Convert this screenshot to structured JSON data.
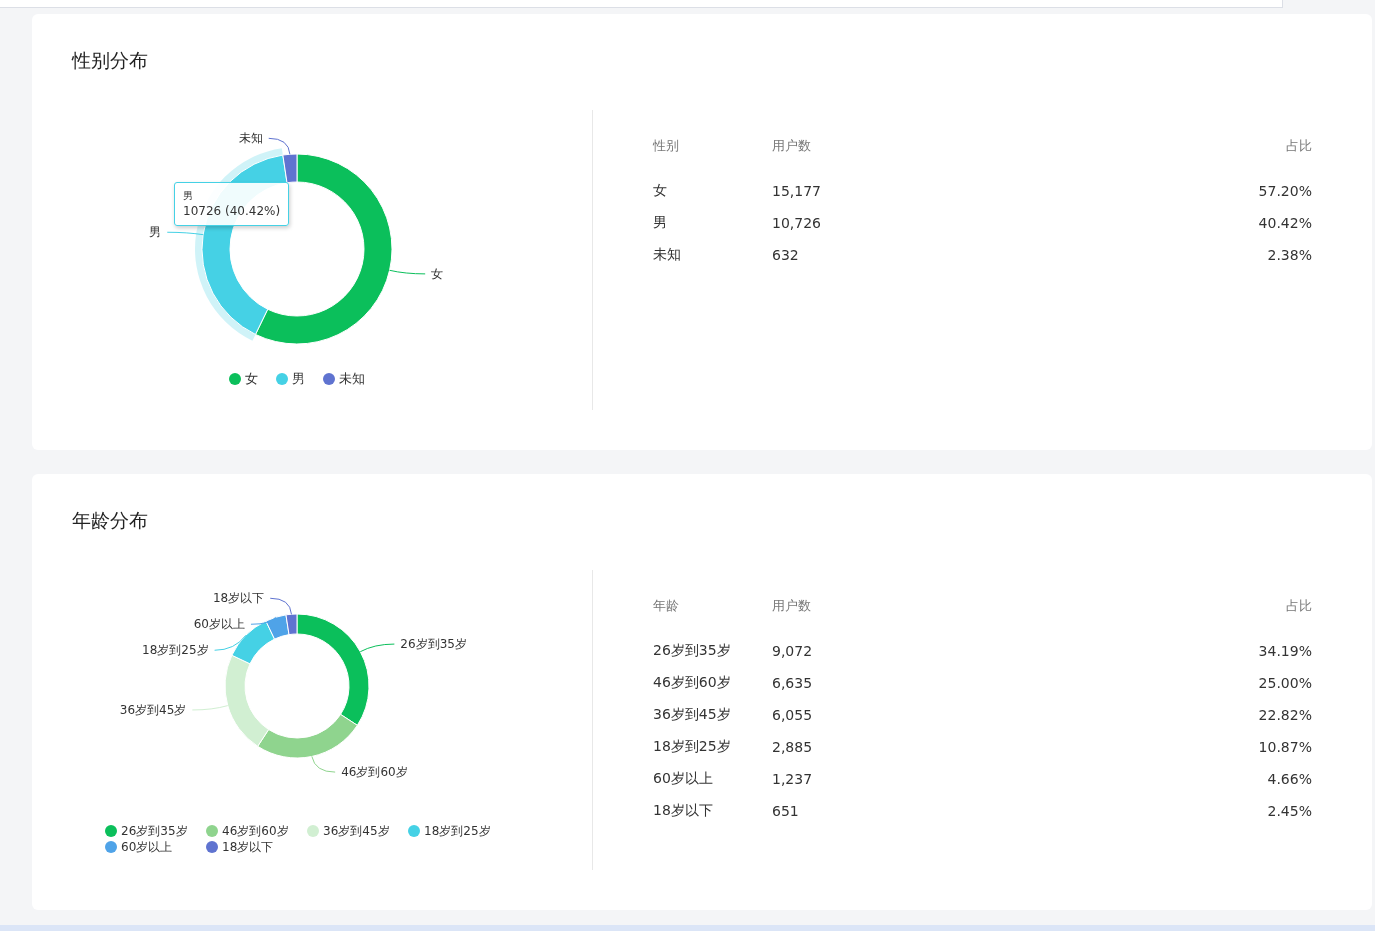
{
  "sections": [
    {
      "title": "性别分布",
      "chart": {
        "chart_data": {
          "type": "donut",
          "categories": [
            "女",
            "男",
            "未知"
          ],
          "values": [
            57.2,
            40.42,
            2.38
          ],
          "colors": [
            "#0bbf5b",
            "#45d1e5",
            "#5f73d0"
          ]
        },
        "emphasized": [
          false,
          true,
          false
        ],
        "tooltip": {
          "title": "男",
          "value": "10726 (40.42%)"
        }
      },
      "table": {
        "columns": [
          "性别",
          "用户数",
          "占比"
        ],
        "rows": [
          [
            "女",
            "15,177",
            "57.20%"
          ],
          [
            "男",
            "10,726",
            "40.42%"
          ],
          [
            "未知",
            "632",
            "2.38%"
          ]
        ]
      }
    },
    {
      "title": "年龄分布",
      "chart": {
        "chart_data": {
          "type": "donut",
          "categories": [
            "26岁到35岁",
            "46岁到60岁",
            "36岁到45岁",
            "18岁到25岁",
            "60岁以上",
            "18岁以下"
          ],
          "values": [
            34.19,
            25.0,
            22.82,
            10.87,
            4.66,
            2.45
          ],
          "colors": [
            "#0bbf5b",
            "#8fd48e",
            "#d1efd2",
            "#45d1e5",
            "#4fa3e8",
            "#5f73d0"
          ]
        },
        "emphasized": [
          false,
          false,
          false,
          false,
          false,
          false
        ]
      },
      "table": {
        "columns": [
          "年龄",
          "用户数",
          "占比"
        ],
        "rows": [
          [
            "26岁到35岁",
            "9,072",
            "34.19%"
          ],
          [
            "46岁到60岁",
            "6,635",
            "25.00%"
          ],
          [
            "36岁到45岁",
            "6,055",
            "22.82%"
          ],
          [
            "18岁到25岁",
            "2,885",
            "10.87%"
          ],
          [
            "60岁以上",
            "1,237",
            "4.66%"
          ],
          [
            "18岁以下",
            "651",
            "2.45%"
          ]
        ]
      }
    }
  ]
}
